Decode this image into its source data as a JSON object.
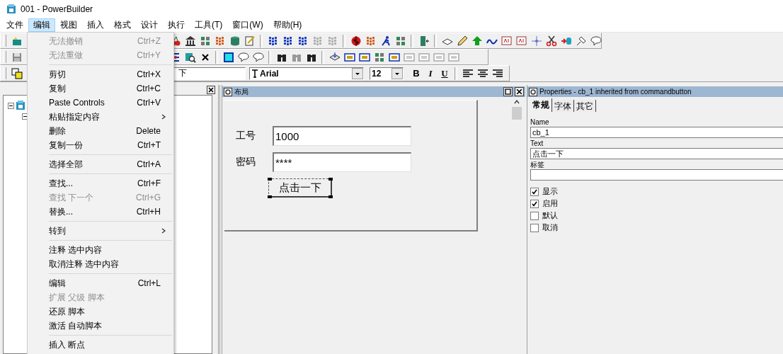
{
  "window": {
    "title": "001 - PowerBuilder"
  },
  "menu_bar": [
    {
      "label": "文件",
      "selected": false
    },
    {
      "label": "编辑",
      "selected": true
    },
    {
      "label": "视图",
      "selected": false
    },
    {
      "label": "插入",
      "selected": false
    },
    {
      "label": "格式",
      "selected": false
    },
    {
      "label": "设计",
      "selected": false
    },
    {
      "label": "执行",
      "selected": false
    },
    {
      "label": "工具(T)",
      "selected": false
    },
    {
      "label": "窗口(W)",
      "selected": false
    },
    {
      "label": "帮助(H)",
      "selected": false
    }
  ],
  "edit_menu": [
    {
      "kind": "item",
      "label": "无法撤销",
      "shortcut": "Ctrl+Z",
      "disabled": true,
      "submenu": false
    },
    {
      "kind": "item",
      "label": "无法重做",
      "shortcut": "Ctrl+Y",
      "disabled": true,
      "submenu": false
    },
    {
      "kind": "separator"
    },
    {
      "kind": "item",
      "label": "剪切",
      "shortcut": "Ctrl+X",
      "disabled": false,
      "submenu": false
    },
    {
      "kind": "item",
      "label": "复制",
      "shortcut": "Ctrl+C",
      "disabled": false,
      "submenu": false
    },
    {
      "kind": "item",
      "label": "Paste Controls",
      "shortcut": "Ctrl+V",
      "disabled": false,
      "submenu": false
    },
    {
      "kind": "item",
      "label": "粘贴指定内容",
      "disabled": false,
      "submenu": true
    },
    {
      "kind": "item",
      "label": "删除",
      "shortcut": "Delete",
      "disabled": false,
      "submenu": false
    },
    {
      "kind": "item",
      "label": "复制一份",
      "shortcut": "Ctrl+T",
      "disabled": false,
      "submenu": false
    },
    {
      "kind": "separator"
    },
    {
      "kind": "item",
      "label": "选择全部",
      "shortcut": "Ctrl+A",
      "disabled": false,
      "submenu": false
    },
    {
      "kind": "separator"
    },
    {
      "kind": "item",
      "label": "查找...",
      "shortcut": "Ctrl+F",
      "disabled": false,
      "submenu": false
    },
    {
      "kind": "item",
      "label": "查找 下一个",
      "shortcut": "Ctrl+G",
      "disabled": true,
      "submenu": false
    },
    {
      "kind": "item",
      "label": "替换...",
      "shortcut": "Ctrl+H",
      "disabled": false,
      "submenu": false
    },
    {
      "kind": "separator"
    },
    {
      "kind": "item",
      "label": "转到",
      "disabled": false,
      "submenu": true
    },
    {
      "kind": "separator"
    },
    {
      "kind": "item",
      "label": "注释 选中内容",
      "disabled": false,
      "submenu": false
    },
    {
      "kind": "item",
      "label": "取消注释 选中内容",
      "disabled": false,
      "submenu": false
    },
    {
      "kind": "separator"
    },
    {
      "kind": "item",
      "label": "编辑",
      "shortcut": "Ctrl+L",
      "disabled": false,
      "submenu": false
    },
    {
      "kind": "item",
      "label": "扩展 父级 脚本",
      "disabled": true,
      "submenu": false
    },
    {
      "kind": "item",
      "label": "还原 脚本",
      "disabled": false,
      "submenu": false
    },
    {
      "kind": "item",
      "label": "激活 自动脚本",
      "disabled": false,
      "submenu": false
    },
    {
      "kind": "separator"
    },
    {
      "kind": "item",
      "label": "插入 断点",
      "disabled": false,
      "submenu": false
    }
  ],
  "format_toolbar": {
    "style_value": "下",
    "font": "Arial",
    "size": "12",
    "style_buttons": [
      "B",
      "I",
      "U"
    ]
  },
  "layout_panel": {
    "title": "布局",
    "form": {
      "fields": [
        {
          "label": "工号",
          "value": "1000"
        },
        {
          "label": "密码",
          "value": "****"
        }
      ],
      "button": {
        "label": "点击一下",
        "selected": true
      }
    }
  },
  "properties_panel": {
    "title": "Properties - cb_1 inherited from commandbutton",
    "tabs": [
      {
        "label": "常规",
        "selected": true
      },
      {
        "label": "字体",
        "selected": false
      },
      {
        "label": "其它",
        "selected": false
      }
    ],
    "fields": [
      {
        "label": "Name",
        "value": "cb_1"
      },
      {
        "label": "Text",
        "value": "点击一下"
      },
      {
        "label": "标签"
      }
    ],
    "checkboxes": [
      {
        "label": "显示",
        "checked": true
      },
      {
        "label": "启用",
        "checked": true
      },
      {
        "label": "默认",
        "checked": false
      },
      {
        "label": "取消",
        "checked": false
      }
    ]
  }
}
